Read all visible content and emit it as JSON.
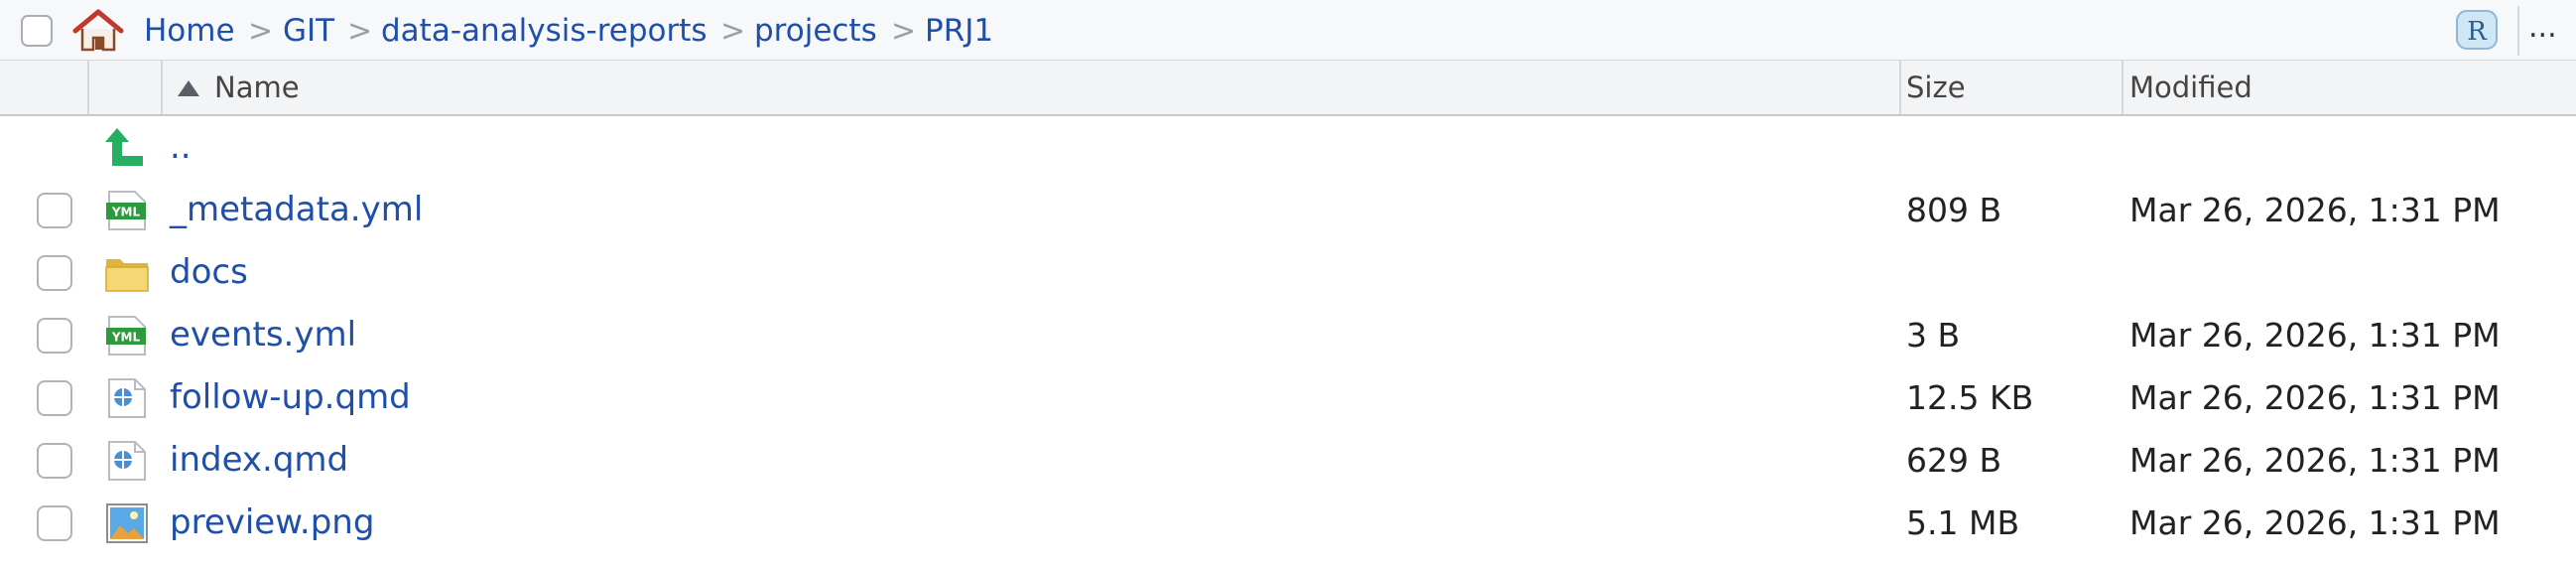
{
  "breadcrumb": {
    "items": [
      "Home",
      "GIT",
      "data-analysis-reports",
      "projects",
      "PRJ1"
    ],
    "separator": ">"
  },
  "toolbar": {
    "more_label": "...",
    "user_icon": "user-icon",
    "home_icon": "home-icon"
  },
  "columns": {
    "name": "Name",
    "size": "Size",
    "modified": "Modified",
    "sort_icon": "sort-ascending-icon"
  },
  "files": [
    {
      "name": "..",
      "size": "",
      "modified": "",
      "icon": "parent-folder-icon",
      "checkbox": false
    },
    {
      "name": "_metadata.yml",
      "size": "809 B",
      "modified": "Mar 26, 2026, 1:31 PM",
      "icon": "yml-file-icon",
      "checkbox": true
    },
    {
      "name": "docs",
      "size": "",
      "modified": "",
      "icon": "folder-icon",
      "checkbox": true
    },
    {
      "name": "events.yml",
      "size": "3 B",
      "modified": "Mar 26, 2026, 1:31 PM",
      "icon": "yml-file-icon",
      "checkbox": true
    },
    {
      "name": "follow-up.qmd",
      "size": "12.5 KB",
      "modified": "Mar 26, 2026, 1:31 PM",
      "icon": "qmd-file-icon",
      "checkbox": true
    },
    {
      "name": "index.qmd",
      "size": "629 B",
      "modified": "Mar 26, 2026, 1:31 PM",
      "icon": "qmd-file-icon",
      "checkbox": true
    },
    {
      "name": "preview.png",
      "size": "5.1 MB",
      "modified": "Mar 26, 2026, 1:31 PM",
      "icon": "image-file-icon",
      "checkbox": true
    }
  ],
  "colors": {
    "link": "#1f4fa8",
    "header_bg": "#f3f4f6",
    "yml_badge": "#2e9a3e",
    "folder": "#f2c94c",
    "up_arrow": "#27ae60"
  }
}
